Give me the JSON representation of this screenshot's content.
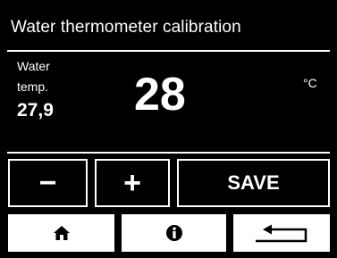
{
  "header": {
    "title": "Water thermometer calibration"
  },
  "reading": {
    "label_line1": "Water",
    "label_line2": "temp.",
    "measured": "27,9",
    "setpoint": "28",
    "unit": "°C"
  },
  "controls": {
    "decrease_label": "−",
    "increase_label": "+",
    "save_label": "SAVE"
  },
  "nav": {
    "home_icon": "home-icon",
    "info_icon": "info-icon",
    "back_icon": "return-arrow-icon"
  }
}
